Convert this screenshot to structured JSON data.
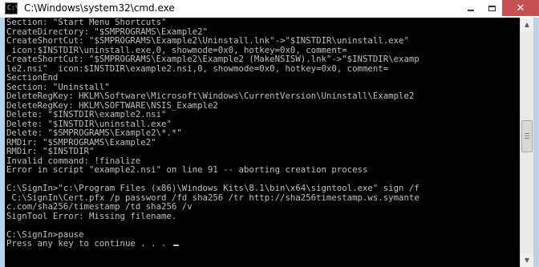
{
  "window": {
    "title": "C:\\Windows\\system32\\cmd.exe",
    "icon_prompt": "C:\\",
    "colors": {
      "frame": "#b9d1ea",
      "console_bg": "#000000",
      "console_text": "#c0c0c0",
      "close_button": "#c75050"
    }
  },
  "caption_buttons": {
    "minimize_icon": "minimize-icon",
    "maximize_icon": "maximize-icon",
    "close_icon": "close-icon",
    "close_glyph": "✕"
  },
  "console": {
    "lines": [
      "Section: \"Start Menu Shortcuts\"",
      "CreateDirectory: \"$SMPROGRAMS\\Example2\"",
      "CreateShortCut: \"$SMPROGRAMS\\Example2\\Uninstall.lnk\"->\"$INSTDIR\\uninstall.exe\"",
      " icon:$INSTDIR\\uninstall.exe,0, showmode=0x0, hotkey=0x0, comment=",
      "CreateShortCut: \"$SMPROGRAMS\\Example2\\Example2 (MakeNSISW).lnk\"->\"$INSTDIR\\examp",
      "le2.nsi\"  icon:$INSTDIR\\example2.nsi,0, showmode=0x0, hotkey=0x0, comment=",
      "SectionEnd",
      "Section: \"Uninstall\"",
      "DeleteRegKey: HKLM\\Software\\Microsoft\\Windows\\CurrentVersion\\Uninstall\\Example2",
      "DeleteRegKey: HKLM\\SOFTWARE\\NSIS_Example2",
      "Delete: \"$INSTDIR\\example2.nsi\"",
      "Delete: \"$INSTDIR\\uninstall.exe\"",
      "Delete: \"$SMPROGRAMS\\Example2\\*.*\"",
      "RMDir: \"$SMPROGRAMS\\Example2\"",
      "RMDir: \"$INSTDIR\"",
      "Invalid command: !finalize",
      "Error in script \"example2.nsi\" on line 91 -- aborting creation process",
      "",
      "C:\\SignIn>\"c:\\Program Files (x86)\\Windows Kits\\8.1\\bin\\x64\\signtool.exe\" sign /f",
      " C:\\SignIn\\Cert.pfx /p password /fd sha256 /tr http://sha256timestamp.ws.symante",
      "c.com/sha256/timestamp /td sha256 /v",
      "SignTool Error: Missing filename.",
      "",
      "C:\\SignIn>pause",
      "Press any key to continue . . . "
    ]
  },
  "scrollbar": {
    "up_icon": "scroll-up-arrow-icon",
    "down_icon": "scroll-down-arrow-icon",
    "up_glyph": "▲",
    "down_glyph": "▼"
  }
}
